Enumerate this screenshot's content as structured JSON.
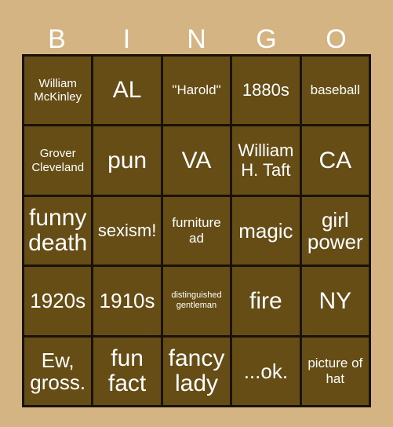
{
  "card": {
    "title_letters": [
      "B",
      "I",
      "N",
      "G",
      "O"
    ],
    "colors": {
      "background": "#d4b483",
      "cell": "#654d15",
      "grid_line": "#1a1208",
      "text": "#ffffff"
    },
    "rows": [
      [
        {
          "text": "William McKinley",
          "size": "sm"
        },
        {
          "text": "AL",
          "size": "xxl"
        },
        {
          "text": "\"Harold\"",
          "size": "md"
        },
        {
          "text": "1880s",
          "size": "lg"
        },
        {
          "text": "baseball",
          "size": "md"
        }
      ],
      [
        {
          "text": "Grover Cleveland",
          "size": "sm"
        },
        {
          "text": "pun",
          "size": "xxl"
        },
        {
          "text": "VA",
          "size": "xxl"
        },
        {
          "text": "William H. Taft",
          "size": "lg"
        },
        {
          "text": "CA",
          "size": "xxl"
        }
      ],
      [
        {
          "text": "funny death",
          "size": "xxl"
        },
        {
          "text": "sexism!",
          "size": "lg"
        },
        {
          "text": "furniture ad",
          "size": "md"
        },
        {
          "text": "magic",
          "size": "xl"
        },
        {
          "text": "girl power",
          "size": "xl"
        }
      ],
      [
        {
          "text": "1920s",
          "size": "xl"
        },
        {
          "text": "1910s",
          "size": "xl"
        },
        {
          "text": "distinguished gentleman",
          "size": "xs"
        },
        {
          "text": "fire",
          "size": "xxl"
        },
        {
          "text": "NY",
          "size": "xxl"
        }
      ],
      [
        {
          "text": "Ew, gross.",
          "size": "xl"
        },
        {
          "text": "fun fact",
          "size": "xxl"
        },
        {
          "text": "fancy lady",
          "size": "xxl"
        },
        {
          "text": "...ok.",
          "size": "xl"
        },
        {
          "text": "picture of hat",
          "size": "md"
        }
      ]
    ]
  }
}
